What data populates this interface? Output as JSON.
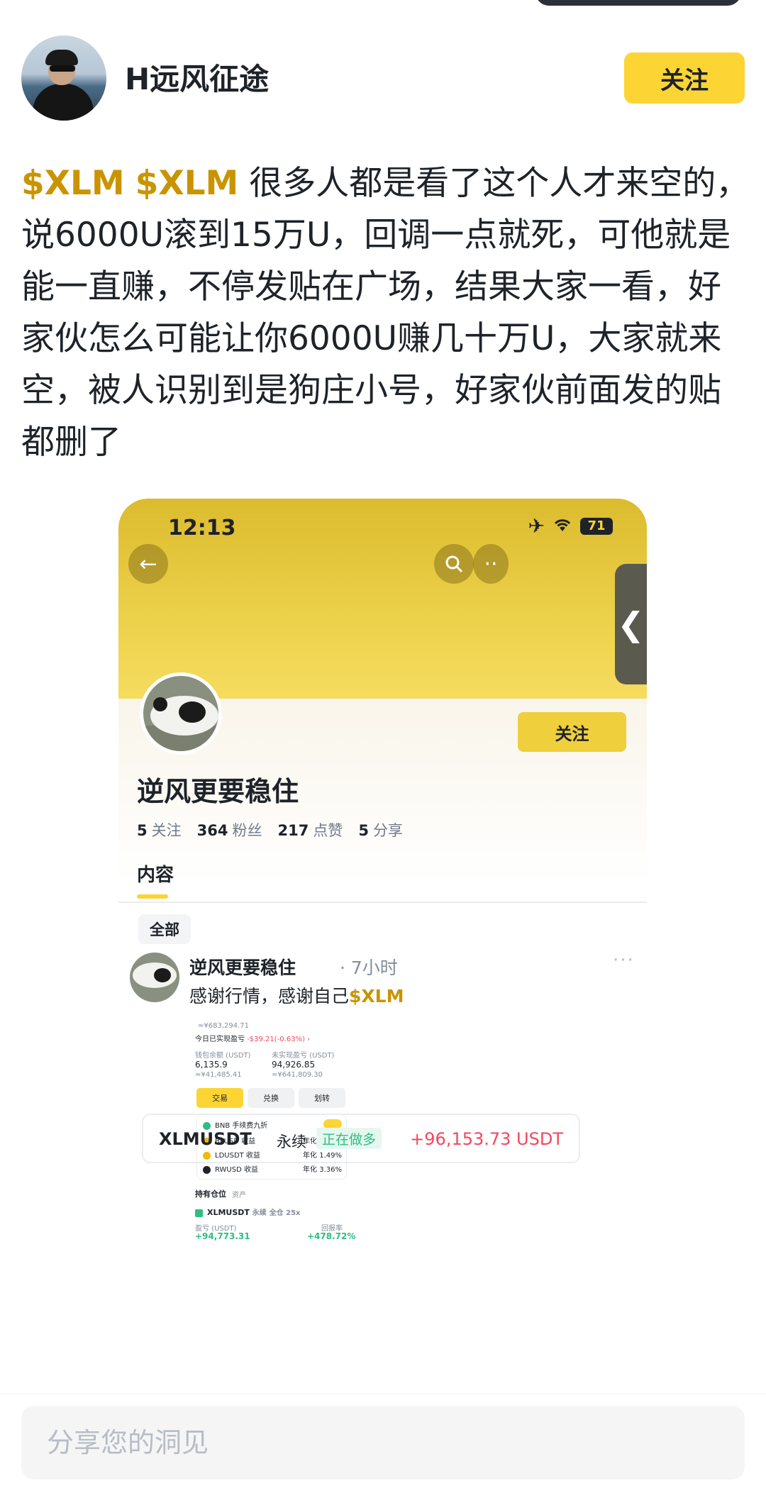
{
  "author": {
    "name": "H远风征途",
    "follow_label": "关注"
  },
  "post": {
    "tag1": "$XLM",
    "tag2": "$XLM",
    "text": " 很多人都是看了这个人才来空的，说6000U滚到15万U，回调一点就死，可他就是能一直赚，不停发贴在广场，结果大家一看，好家伙怎么可能让你6000U赚几十万U，大家就来空，被人识别到是狗庄小号，好家伙前面发的贴都删了"
  },
  "screenshot": {
    "time": "12:13",
    "battery": "71",
    "side_tab_glyph": "❮",
    "profile": {
      "name": "逆风更要稳住",
      "follow_label": "关注",
      "stats": [
        {
          "value": "5",
          "label": "关注"
        },
        {
          "value": "364",
          "label": "粉丝"
        },
        {
          "value": "217",
          "label": "点赞"
        },
        {
          "value": "5",
          "label": "分享"
        }
      ],
      "tab": "内容",
      "filter_chip": "全部"
    },
    "feed_post": {
      "author": "逆风更要稳住",
      "time": "· 7小时",
      "body": "感谢行情，感谢自己",
      "tag": "$XLM",
      "more": "···"
    },
    "wallet": {
      "total_approx": "≈¥683,294.71",
      "today_pnl_label": "今日已实现盈亏",
      "today_pnl_value": "-$39.21(-0.63%)",
      "wallet_balance_label": "钱包余额 (USDT)",
      "wallet_balance_value": "6,135.9",
      "wallet_balance_cny": "≈¥41,485.41",
      "unrealized_label": "未实现盈亏 (USDT)",
      "unrealized_value": "94,926.85",
      "unrealized_cny": "≈¥641,809.30",
      "btn_trade": "交易",
      "btn_convert": "兑换",
      "btn_transfer": "划转",
      "fee_discount": "BNB 手续费九折",
      "earn_rows": [
        {
          "name": "BFUSD 收益",
          "rate": "年化 2.38%"
        },
        {
          "name": "LDUSDT 收益",
          "rate": "年化 1.49%"
        },
        {
          "name": "RWUSD 收益",
          "rate": "年化 3.36%"
        }
      ],
      "tab_positions": "持有仓位",
      "tab_assets": "资产",
      "position_symbol": "XLMUSDT",
      "position_type": "永续",
      "position_mode": "全仓 25x",
      "pnl_label": "盈亏 (USDT)",
      "roi_label": "回报率",
      "pnl_value": "+94,773.31",
      "roi_value": "+478.72%"
    },
    "position_card": {
      "symbol": "XLMUSDT",
      "type": "永续",
      "status": "正在做多",
      "pnl": "+96,153.73 USDT"
    }
  },
  "comment": {
    "placeholder": "分享您的洞见"
  },
  "colors": {
    "accent": "#fcd535",
    "tag": "#c99400",
    "profit": "#2ebd85",
    "loss": "#f6465d"
  }
}
